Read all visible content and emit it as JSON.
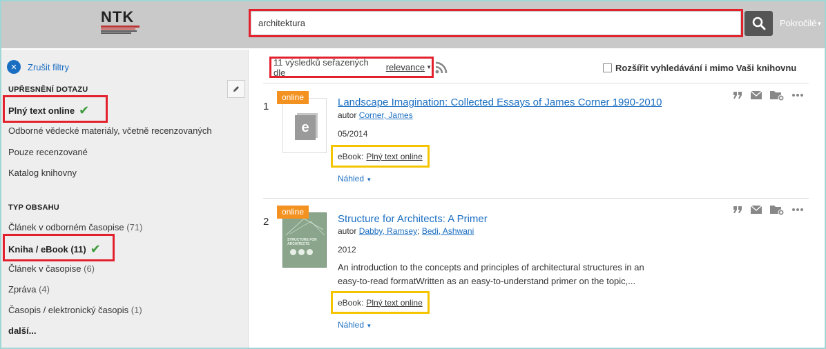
{
  "header": {
    "logo_text": "NTK",
    "search_value": "architektura",
    "advanced_label": "Pokročilé"
  },
  "sidebar": {
    "clear_filters": "Zrušit filtry",
    "refine_title": "UPŘESNĚNÍ DOTAZU",
    "refine_items": [
      {
        "label": "Plný text online",
        "selected": true
      },
      {
        "label": "Odborné vědecké materiály, včetně recenzovaných"
      },
      {
        "label": "Pouze recenzované"
      },
      {
        "label": "Katalog knihovny"
      }
    ],
    "type_title": "TYP OBSAHU",
    "type_items": [
      {
        "label": "Článek v odborném časopise",
        "count": "(71)"
      },
      {
        "label": "Kniha / eBook",
        "count": "(11)",
        "selected": true
      },
      {
        "label": "Článek v časopise",
        "count": "(6)"
      },
      {
        "label": "Zpráva",
        "count": "(4)"
      },
      {
        "label": "Časopis / elektronický časopis",
        "count": "(1)"
      }
    ],
    "more": "další..."
  },
  "main": {
    "sort_prefix": "11 výsledků seřazených dle",
    "sort_value": "relevance",
    "extend_label": "Rozšířit vyhledávání i mimo Vaši knihovnu",
    "results": [
      {
        "number": "1",
        "badge": "online",
        "title": "Landscape Imagination: Collected Essays of James Corner 1990-2010",
        "author_prefix": "autor",
        "authors": [
          "Corner, James"
        ],
        "date": "05/2014",
        "format_label": "eBook:",
        "fulltext_link": "Plný text online",
        "preview": "Náhled"
      },
      {
        "number": "2",
        "badge": "online",
        "title": "Structure for Architects: A Primer",
        "author_prefix": "autor",
        "authors": [
          "Dabby, Ramsey",
          "Bedi, Ashwani"
        ],
        "date": "2012",
        "description_1": "An introduction to the concepts and principles of architectural structures in an",
        "description_2": "easy-to-read formatWritten as an easy-to-understand primer on the topic,...",
        "cover_text": "STRUCTURE FOR ARCHITECTS",
        "format_label": "eBook:",
        "fulltext_link": "Plný text online",
        "preview": "Náhled"
      }
    ]
  },
  "colors": {
    "accent_blue": "#1a6ec2",
    "highlight_red": "#e3212d",
    "highlight_yellow": "#f5c400",
    "online_badge": "#f39220",
    "check_green": "#3c9a3c"
  }
}
